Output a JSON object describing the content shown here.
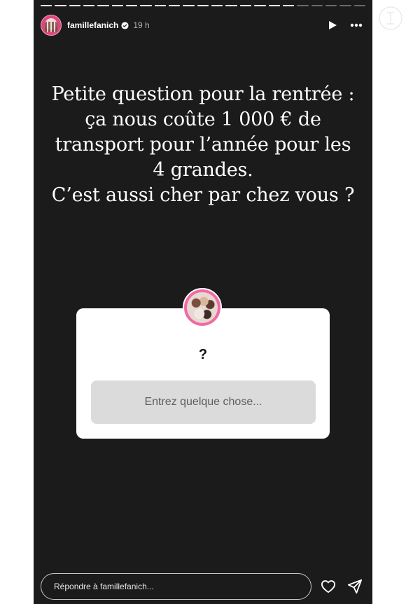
{
  "header": {
    "username": "famillefanich",
    "time": "19 h"
  },
  "progress": {
    "segments": [
      1,
      1,
      1,
      1,
      1,
      1,
      1,
      1,
      1,
      1,
      1,
      1,
      1,
      1,
      1,
      1,
      1,
      1,
      0,
      0,
      0,
      0,
      0
    ]
  },
  "story": {
    "text": "Petite question pour la rentrée :\nça nous coûte 1 000 € de\ntransport pour l’année pour les\n4 grandes.\nC’est aussi cher par chez vous ?"
  },
  "sticker": {
    "question": "?",
    "placeholder": "Entrez quelque chose..."
  },
  "reply": {
    "placeholder": "Répondre à famillefanich..."
  },
  "icons": {
    "play": "play-icon",
    "more": "more-icon",
    "verified": "verified-badge-icon",
    "like": "heart-icon",
    "share": "send-icon"
  },
  "colors": {
    "background": "#1b1b1b",
    "sticker_input": "#dbdbdb",
    "avatar_ring": "#f06ba5"
  }
}
